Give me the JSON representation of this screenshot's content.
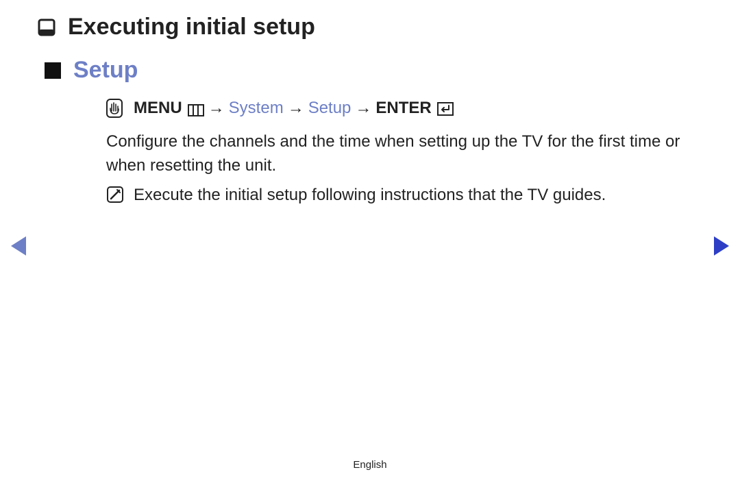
{
  "chapter": {
    "title": "Executing initial setup"
  },
  "section": {
    "title": "Setup"
  },
  "navpath": {
    "menu_label": "MENU",
    "system": "System",
    "setup": "Setup",
    "enter_label": "ENTER",
    "arrow": "→"
  },
  "body": {
    "paragraph": "Configure the channels and the time when setting up the TV for the first time or when resetting the unit."
  },
  "note": {
    "text": "Execute the initial setup following instructions that the TV guides."
  },
  "footer": {
    "language": "English"
  }
}
